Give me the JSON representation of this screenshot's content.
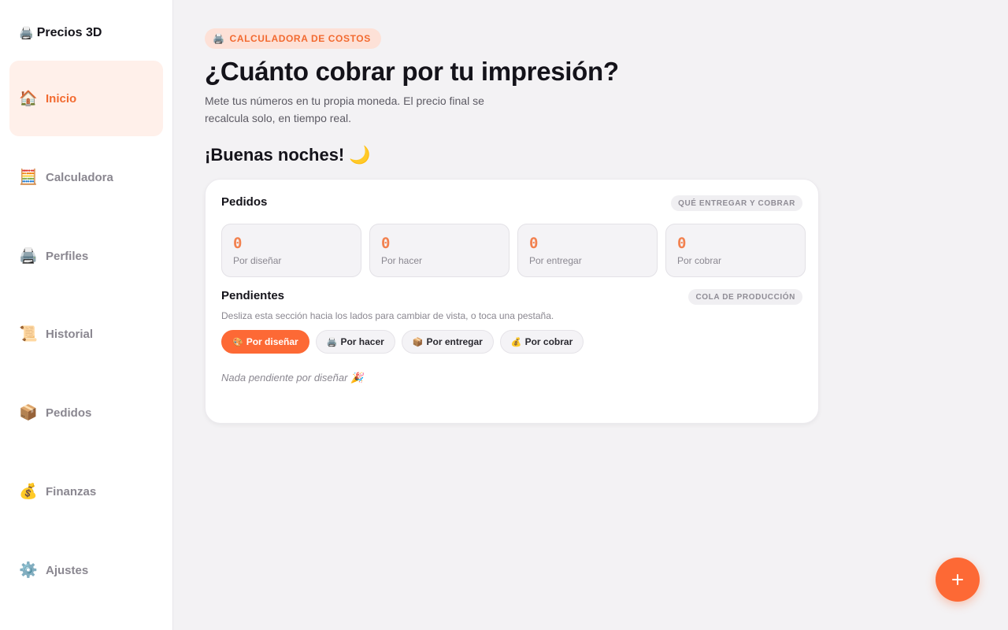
{
  "sidebar": {
    "brand": {
      "icon": "🖨️",
      "name": "Precios 3D"
    },
    "items": [
      {
        "icon": "🏠",
        "label": "Inicio",
        "active": true
      },
      {
        "icon": "🧮",
        "label": "Calculadora"
      },
      {
        "icon": "🖨️",
        "label": "Perfiles"
      },
      {
        "icon": "📜",
        "label": "Historial"
      },
      {
        "icon": "📦",
        "label": "Pedidos"
      },
      {
        "icon": "💰",
        "label": "Finanzas"
      },
      {
        "icon": "⚙️",
        "label": "Ajustes"
      }
    ]
  },
  "header": {
    "pill": {
      "icon": "🖨️",
      "label": "CALCULADORA DE COSTOS"
    },
    "title": "¿Cuánto cobrar por tu impresión?",
    "subtitle": "Mete tus números en tu propia moneda. El precio final se recalcula solo, en tiempo real.",
    "greeting": "¡Buenas noches! 🌙"
  },
  "orders": {
    "title": "Pedidos",
    "chip": "QUÉ ENTREGAR Y COBRAR",
    "stats": [
      {
        "value": "0",
        "label": "Por diseñar"
      },
      {
        "value": "0",
        "label": "Por hacer"
      },
      {
        "value": "0",
        "label": "Por entregar"
      },
      {
        "value": "0",
        "label": "Por cobrar"
      }
    ]
  },
  "pending": {
    "title": "Pendientes",
    "chip": "COLA DE PRODUCCIÓN",
    "hint": "Desliza esta sección hacia los lados para cambiar de vista, o toca una pestaña.",
    "tabs": [
      {
        "icon": "🎨",
        "label": "Por diseñar",
        "active": true
      },
      {
        "icon": "🖨️",
        "label": "Por hacer"
      },
      {
        "icon": "📦",
        "label": "Por entregar"
      },
      {
        "icon": "💰",
        "label": "Por cobrar"
      }
    ],
    "empty_message": "Nada pendiente por diseñar 🎉"
  },
  "fab": {
    "icon": "plus-icon"
  },
  "colors": {
    "accent": "#fd6935",
    "accent_soft": "#fff0ea",
    "background": "#f3f2f4"
  }
}
